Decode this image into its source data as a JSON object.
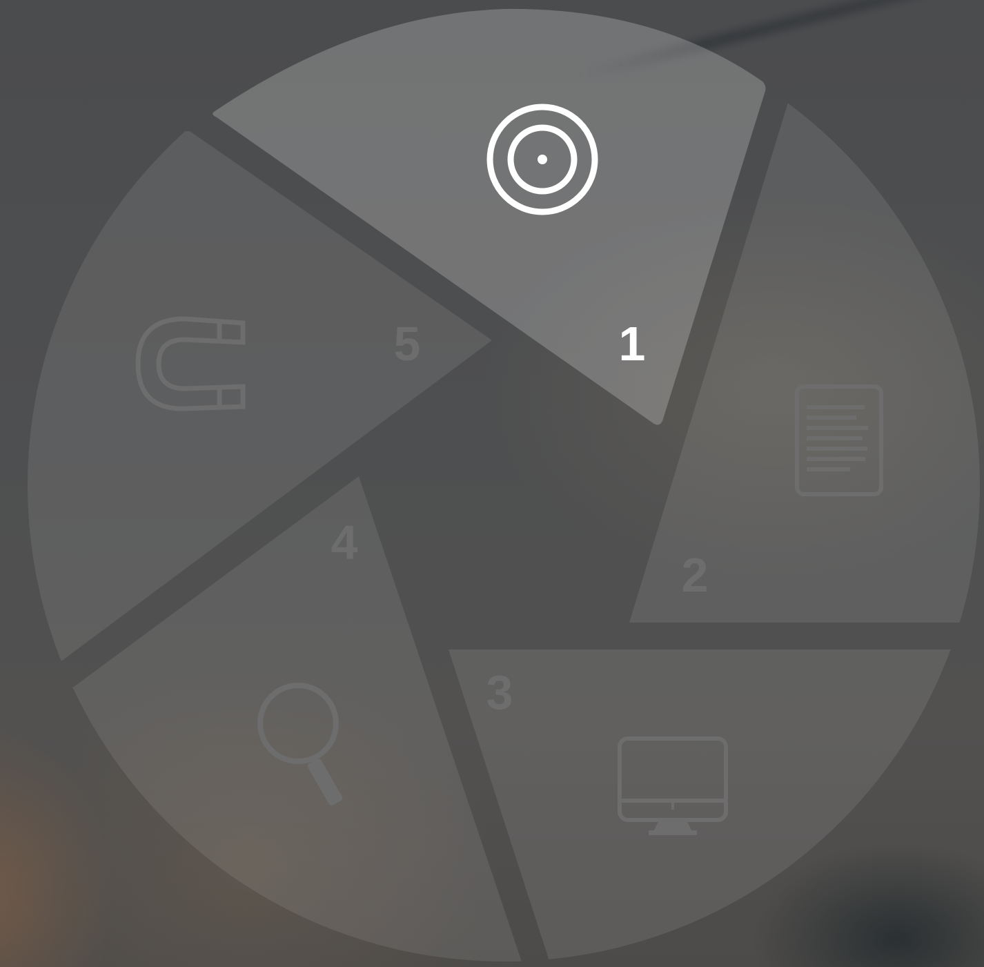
{
  "wheel": {
    "active_color": "#ffffff",
    "inactive_color": "#6d6d6d",
    "segments": [
      {
        "number": "1",
        "icon": "target-icon",
        "active": true
      },
      {
        "number": "2",
        "icon": "document-icon",
        "active": false
      },
      {
        "number": "3",
        "icon": "monitor-icon",
        "active": false
      },
      {
        "number": "4",
        "icon": "search-icon",
        "active": false
      },
      {
        "number": "5",
        "icon": "magnet-icon",
        "active": false
      }
    ]
  }
}
